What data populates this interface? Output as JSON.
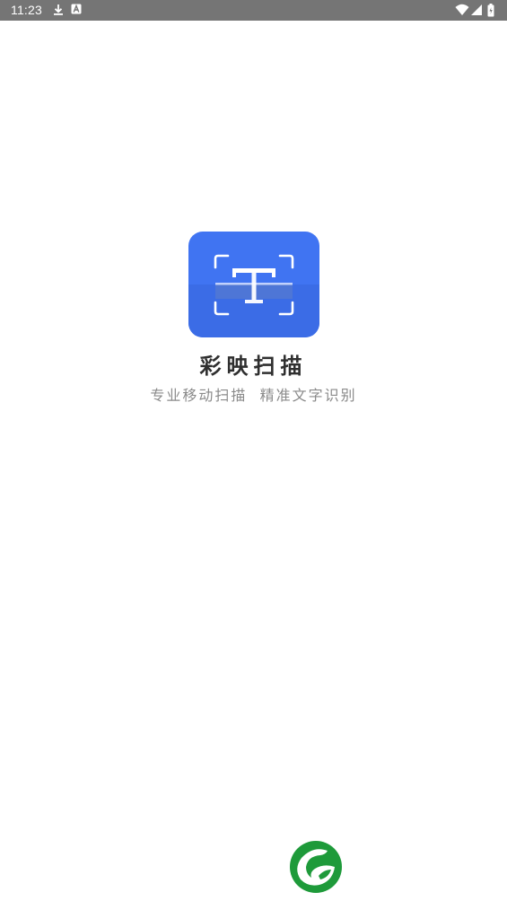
{
  "status_bar": {
    "time": "11:23",
    "left_icons": [
      "download-icon",
      "a-badge-icon"
    ],
    "right_icons": [
      "wifi-icon",
      "signal-icon",
      "battery-icon"
    ],
    "background": "#757575"
  },
  "splash": {
    "app_name": "彩映扫描",
    "slogan": "专业移动扫描  精准文字识别",
    "logo_icon": "text-scan-icon",
    "logo_color": "#4074f2"
  },
  "footer": {
    "brand_icon": "green-leaf-logo-icon",
    "brand_color": "#1e9a3a"
  }
}
